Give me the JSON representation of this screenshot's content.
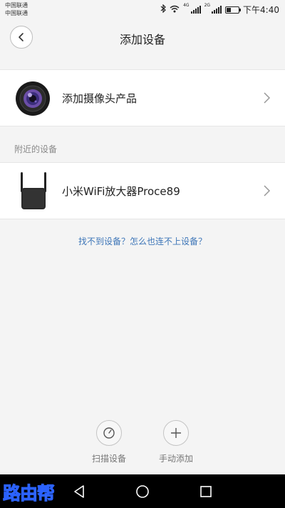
{
  "status_bar": {
    "carrier1": "中国联通",
    "carrier2": "中国联通",
    "net1": "4G",
    "net2": "2G",
    "battery_level": 0.35,
    "time": "下午4:40"
  },
  "header": {
    "title": "添加设备"
  },
  "camera_row": {
    "label": "添加摄像头产品"
  },
  "nearby": {
    "section_label": "附近的设备",
    "device_label": "小米WiFi放大器Proce89"
  },
  "help_link": "找不到设备？怎么也连不上设备？",
  "actions": {
    "scan_label": "扫描设备",
    "manual_label": "手动添加"
  },
  "watermark": "路由帮",
  "colors": {
    "link": "#3e76b8",
    "background": "#f4f4f4"
  }
}
